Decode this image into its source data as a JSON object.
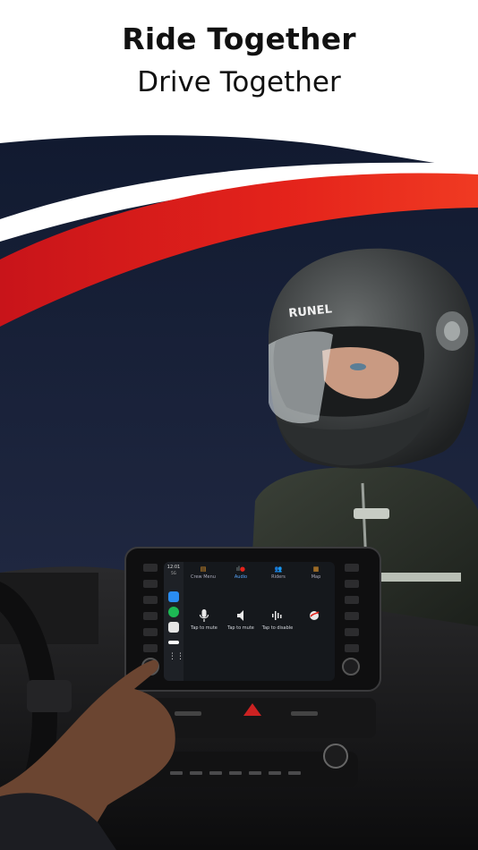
{
  "headline": {
    "title": "Ride Together",
    "subtitle": "Drive Together"
  },
  "helmet": {
    "brand_text": "RUNEL"
  },
  "carplay": {
    "time": "12:01",
    "signal": "5G",
    "tabs": [
      {
        "label": "Crew Menu",
        "icon": "crew-menu-icon"
      },
      {
        "label": "Audio",
        "icon": "audio-icon"
      },
      {
        "label": "Riders",
        "icon": "riders-icon"
      },
      {
        "label": "Map",
        "icon": "map-icon"
      }
    ],
    "active_tab": "Audio",
    "controls": [
      {
        "label": "Tap to mute",
        "icon": "microphone-icon"
      },
      {
        "label": "Tap to mute",
        "icon": "speaker-icon"
      },
      {
        "label": "Tap to disable",
        "icon": "voice-activation-icon"
      },
      {
        "label": "",
        "icon": "app-logo-icon"
      }
    ]
  },
  "colors": {
    "brand_red": "#e4231b",
    "navy": "#1a2238",
    "accent_blue": "#59a8ff",
    "accent_orange": "#e89a2c"
  }
}
